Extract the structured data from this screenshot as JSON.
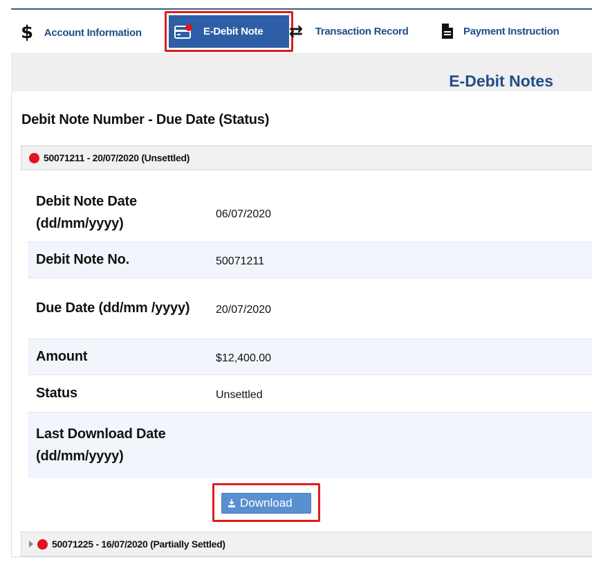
{
  "nav": {
    "items": [
      {
        "label": "Account Information",
        "icon": "dollar-icon"
      },
      {
        "label": "E-Debit Note",
        "icon": "card-icon",
        "active": true
      },
      {
        "label": "Transaction Record",
        "icon": "exchange-arrows-icon"
      },
      {
        "label": "Payment Instruction",
        "icon": "document-icon"
      }
    ],
    "dollar_glyph": "$",
    "exchange_glyph": "⇄"
  },
  "page": {
    "title": "E-Debit Notes",
    "section_heading": "Debit Note Number - Due Date (Status)"
  },
  "notes": [
    {
      "header": "50071211 - 20/07/2020 (Unsettled)",
      "expanded": true,
      "details": [
        {
          "label": "Debit Note Date (dd/mm/yyyy)",
          "value": "06/07/2020"
        },
        {
          "label": "Debit Note No.",
          "value": "50071211"
        },
        {
          "label": "Due Date (dd/mm /yyyy)",
          "value": "20/07/2020"
        },
        {
          "label": "Amount",
          "value": "$12,400.00"
        },
        {
          "label": "Status",
          "value": "Unsettled"
        },
        {
          "label": "Last Download Date (dd/mm/yyyy)",
          "value": ""
        }
      ],
      "download_label": "Download"
    },
    {
      "header": "50071225 - 16/07/2020 (Partially Settled)",
      "expanded": false
    }
  ],
  "colors": {
    "brand_blue": "#1f4d8a",
    "active_tab": "#2d5ea6",
    "status_dot": "#e5111d",
    "highlight_outline": "#e01b1b",
    "button": "#5a8fd0"
  }
}
